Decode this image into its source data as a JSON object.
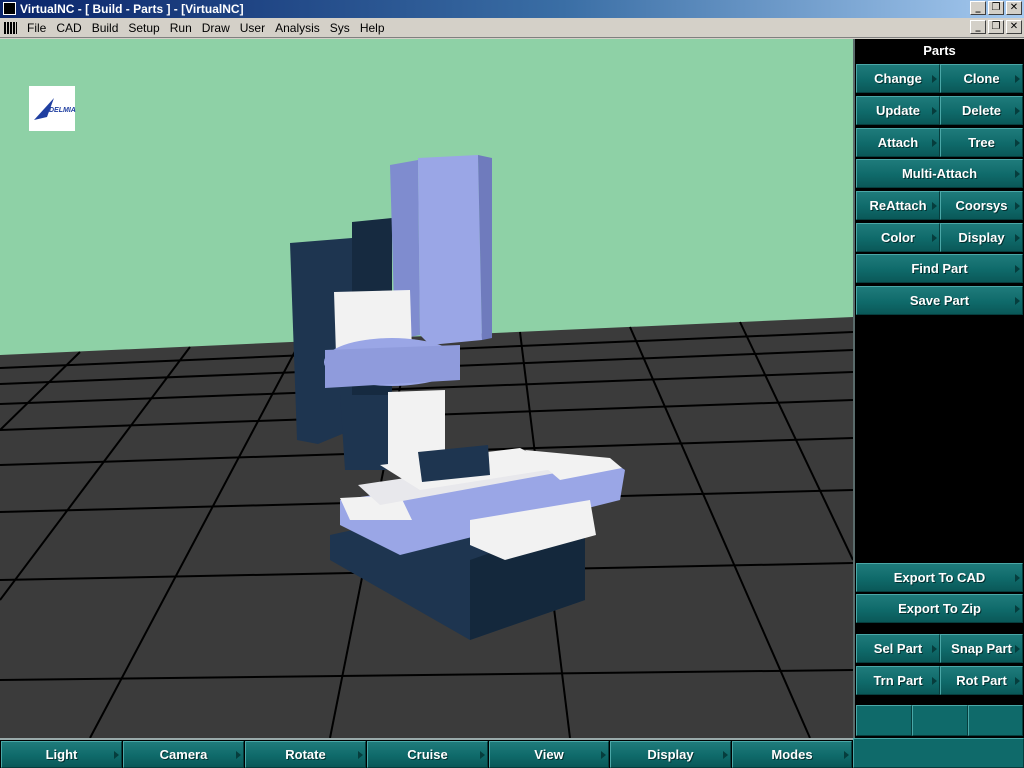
{
  "window": {
    "title": "VirtualNC - [ Build - Parts ] - [VirtualNC]",
    "controls": [
      "_",
      "❐",
      "✕"
    ]
  },
  "menu": {
    "items": [
      "File",
      "CAD",
      "Build",
      "Setup",
      "Run",
      "Draw",
      "User",
      "Analysis",
      "Sys",
      "Help"
    ]
  },
  "viewport": {
    "logo_text": "DELMIA",
    "colors": {
      "sky": "#8ed1a6",
      "floor": "#3b3b3b",
      "grid": "#000000",
      "dark_part": "#1e3550",
      "light_part": "#9aa6e6",
      "white_part": "#f2f2f2"
    }
  },
  "panel": {
    "title": "Parts",
    "buttons": {
      "change": "Change",
      "clone": "Clone",
      "update": "Update",
      "delete": "Delete",
      "attach": "Attach",
      "tree": "Tree",
      "multi_attach": "Multi-Attach",
      "reattach": "ReAttach",
      "coorsys": "Coorsys",
      "color": "Color",
      "display": "Display",
      "find_part": "Find Part",
      "save_part": "Save Part",
      "export_cad": "Export To CAD",
      "export_zip": "Export To Zip",
      "sel_part": "Sel Part",
      "snap_part": "Snap Part",
      "trn_part": "Trn Part",
      "rot_part": "Rot Part"
    },
    "accent": "#0f6a6a"
  },
  "bottom": {
    "buttons": [
      "Light",
      "Camera",
      "Rotate",
      "Cruise",
      "View",
      "Display",
      "Modes"
    ]
  }
}
